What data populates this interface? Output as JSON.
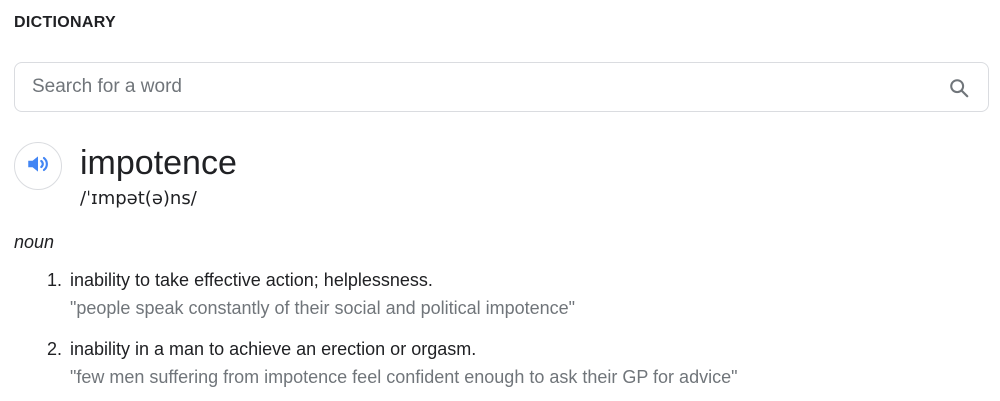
{
  "header": {
    "title": "DICTIONARY"
  },
  "search": {
    "placeholder": "Search for a word",
    "value": ""
  },
  "entry": {
    "word": "impotence",
    "phonetic": "/ˈɪmpət(ə)ns/",
    "part_of_speech": "noun",
    "senses": [
      {
        "number": "1.",
        "definition": "inability to take effective action; helplessness.",
        "example": "\"people speak constantly of their social and political impotence\""
      },
      {
        "number": "2.",
        "definition": "inability in a man to achieve an erection or orgasm.",
        "example": "\"few men suffering from impotence feel confident enough to ask their GP for advice\""
      }
    ]
  },
  "icons": {
    "search": "search-icon",
    "speaker": "speaker-icon"
  },
  "colors": {
    "accent": "#4285f4",
    "text": "#202124",
    "muted": "#70757a",
    "border": "#dadce0"
  }
}
